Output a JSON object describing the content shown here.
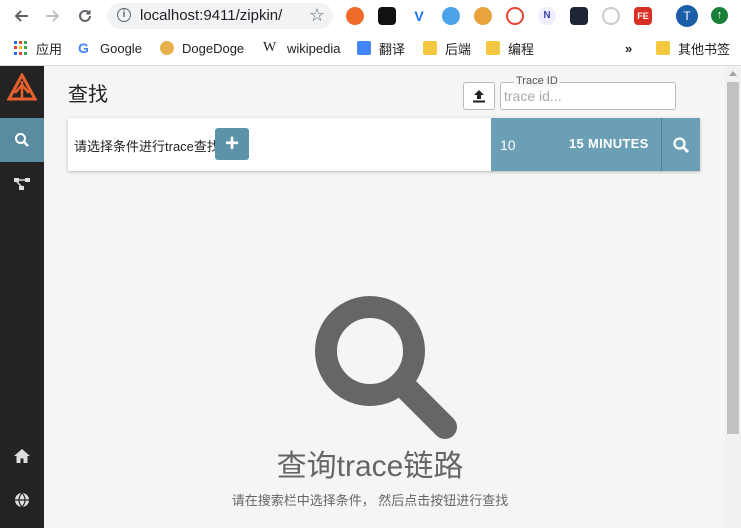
{
  "browser": {
    "url": "localhost:9411/zipkin/",
    "bookmarks": [
      {
        "label": "应用",
        "icon": "apps-icon"
      },
      {
        "label": "Google",
        "icon": "google-icon"
      },
      {
        "label": "DogeDoge",
        "icon": "dogedoge-icon"
      },
      {
        "label": "wikipedia",
        "icon": "wikipedia-icon"
      },
      {
        "label": "翻译",
        "icon": "translate-icon"
      },
      {
        "label": "后端",
        "icon": "folder-icon"
      },
      {
        "label": "编程",
        "icon": "folder-icon"
      }
    ],
    "more_label": "»",
    "other_bookmarks": "其他书签",
    "profile_initial": "T"
  },
  "app": {
    "page_title": "查找",
    "trace_id_label": "Trace ID",
    "trace_id_placeholder": "trace id...",
    "search_hint": "请选择条件进行trace查找",
    "add_label": "+",
    "limit": "10",
    "lookback": "15 MINUTES",
    "empty_title": "查询trace链路",
    "empty_subtitle": "请在搜索栏中选择条件， 然后点击按钮进行查找"
  },
  "colors": {
    "sidebar_bg": "#232323",
    "sidebar_active": "#5a8ba0",
    "accent": "#6a9fb5",
    "logo": "#e8602c"
  }
}
